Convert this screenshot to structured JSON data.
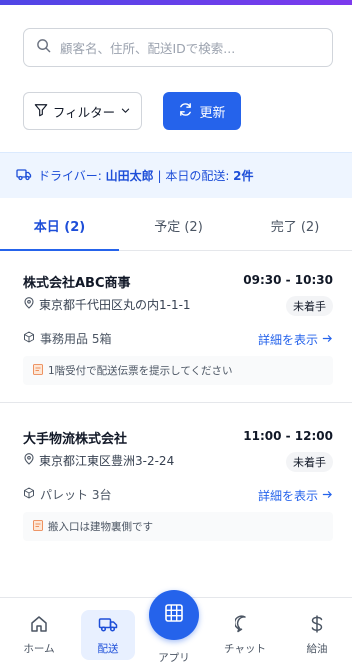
{
  "search": {
    "placeholder": "顧客名、住所、配送IDで検索..."
  },
  "toolbar": {
    "filter_label": "フィルター",
    "refresh_label": "更新"
  },
  "driver_bar": {
    "prefix": "ドライバー: ",
    "driver_name": "山田太郎",
    "middle": " | 本日の配送: ",
    "count": "2件"
  },
  "tabs": [
    {
      "label": "本日 (2)",
      "active": true
    },
    {
      "label": "予定 (2)",
      "active": false
    },
    {
      "label": "完了 (2)",
      "active": false
    }
  ],
  "deliveries": [
    {
      "customer": "株式会社ABC商事",
      "time": "09:30 - 10:30",
      "address": "東京都千代田区丸の内1-1-1",
      "status": "未着手",
      "items": "事務用品 5箱",
      "detail_label": "詳細を表示",
      "note": "1階受付で配送伝票を提示してください"
    },
    {
      "customer": "大手物流株式会社",
      "time": "11:00 - 12:00",
      "address": "東京都江東区豊洲3-2-24",
      "status": "未着手",
      "items": "パレット 3台",
      "detail_label": "詳細を表示",
      "note": "搬入口は建物裏側です"
    }
  ],
  "nav": {
    "home": "ホーム",
    "delivery": "配送",
    "apps": "アプリ",
    "chat": "チャット",
    "fuel": "給油"
  },
  "colors": {
    "accent": "#2563eb",
    "active_bg": "#e8f0ff",
    "driver_bar_bg": "#eef5ff"
  }
}
